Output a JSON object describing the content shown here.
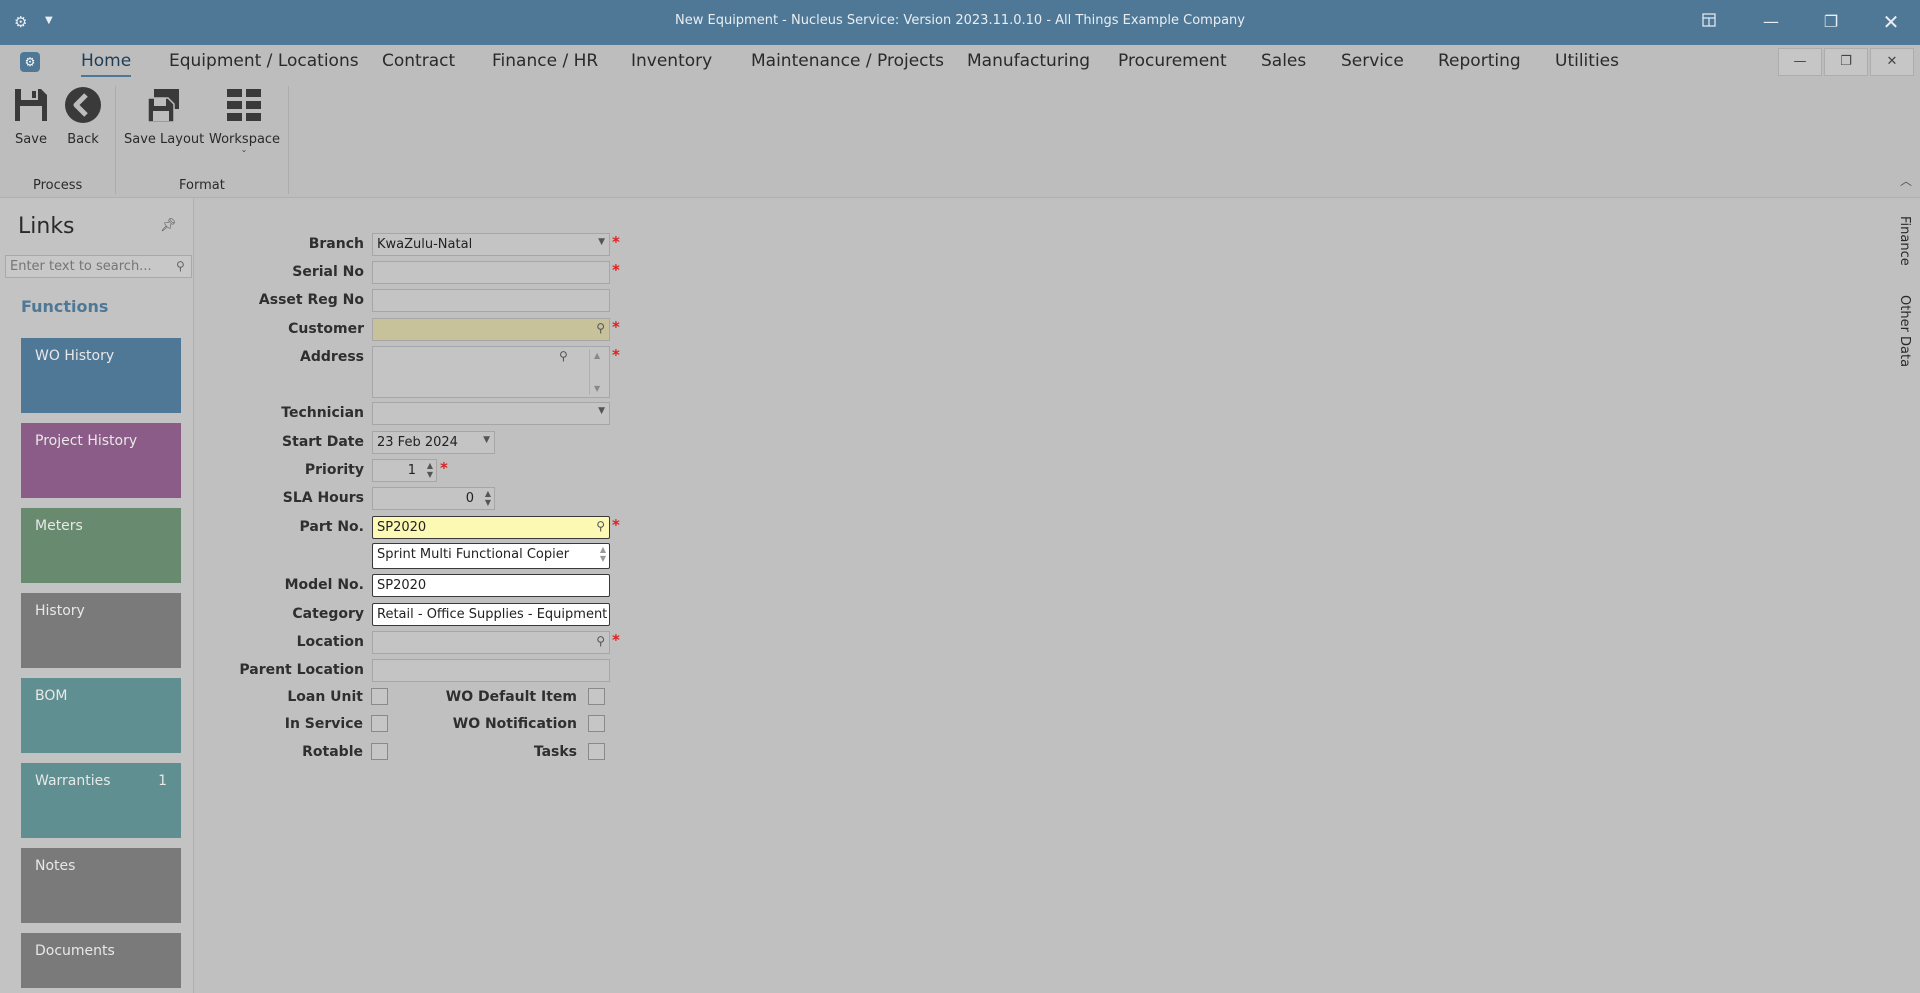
{
  "window": {
    "title": "New Equipment - Nucleus Service: Version 2023.11.0.10 - All Things Example Company",
    "app_icon": "gear-icon",
    "controls": [
      "restore-layout-icon",
      "minimize-icon",
      "restore-icon",
      "close-icon"
    ]
  },
  "menu": {
    "items": [
      "Home",
      "Equipment / Locations",
      "Contract",
      "Finance / HR",
      "Inventory",
      "Maintenance / Projects",
      "Manufacturing",
      "Procurement",
      "Sales",
      "Service",
      "Reporting",
      "Utilities"
    ],
    "active": "Home"
  },
  "ribbon": {
    "save": "Save",
    "back": "Back",
    "save_layout": "Save Layout",
    "workspace": "Workspace",
    "group_process": "Process",
    "group_format": "Format"
  },
  "links": {
    "title": "Links",
    "search_placeholder": "Enter text to search...",
    "functions_title": "Functions",
    "tiles": [
      {
        "label": "WO History",
        "color": "#4f7896"
      },
      {
        "label": "Project History",
        "color": "#8b5c87"
      },
      {
        "label": "Meters",
        "color": "#688a6e"
      },
      {
        "label": "History",
        "color": "#7a7a7a"
      },
      {
        "label": "BOM",
        "color": "#5f8f90"
      },
      {
        "label": "Warranties",
        "color": "#5f8f90",
        "count": "1"
      },
      {
        "label": "Notes",
        "color": "#7a7a7a"
      },
      {
        "label": "Documents",
        "color": "#7a7a7a"
      }
    ]
  },
  "form": {
    "labels": {
      "branch": "Branch",
      "serial_no": "Serial No",
      "asset_reg_no": "Asset Reg No",
      "customer": "Customer",
      "address": "Address",
      "technician": "Technician",
      "start_date": "Start Date",
      "priority": "Priority",
      "sla_hours": "SLA Hours",
      "part_no": "Part No.",
      "model_no": "Model No.",
      "category": "Category",
      "location": "Location",
      "parent_location": "Parent Location",
      "loan_unit": "Loan Unit",
      "in_service": "In Service",
      "rotable": "Rotable",
      "wo_default_item": "WO Default Item",
      "wo_notification": "WO Notification",
      "tasks": "Tasks"
    },
    "values": {
      "branch": "KwaZulu-Natal",
      "serial_no": "",
      "asset_reg_no": "",
      "customer": "",
      "address": "",
      "technician": "",
      "start_date": "23 Feb 2024",
      "priority": "1",
      "sla_hours": "0",
      "part_no": "SP2020",
      "part_description": "Sprint Multi Functional Copier",
      "model_no": "SP2020",
      "category": "Retail - Office Supplies - Equipment",
      "location": "",
      "parent_location": ""
    },
    "required_mark": "*"
  },
  "side_tabs": [
    "Finance",
    "Other Data"
  ]
}
